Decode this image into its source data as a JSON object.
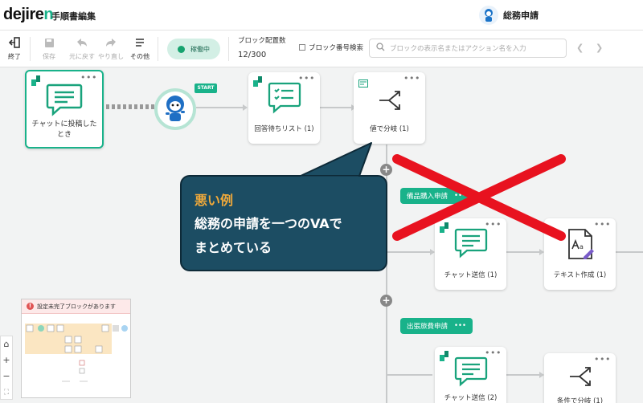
{
  "header": {
    "logo_main": "dejire",
    "logo_accent": "n",
    "title": "手順書編集",
    "project_name": "総務申請"
  },
  "toolbar": {
    "exit": "終了",
    "save": "保存",
    "undo": "元に戻す",
    "redo": "やり直し",
    "more": "その他",
    "status": "稼働中",
    "block_count_label": "ブロック配置数",
    "block_count_value": "12/300",
    "block_search_label": "ブロック番号検索",
    "search_placeholder": "ブロックの表示名またはアクション名を入力",
    "prev_icon": "chevron-left-icon",
    "next_icon": "chevron-right-icon"
  },
  "flow": {
    "trigger_label_l1": "チャットに投稿した",
    "trigger_label_l2": "とき",
    "start_badge": "START",
    "node_wait": "回答待ちリスト (1)",
    "node_branch": "値で分岐 (1)",
    "tag1": "備品購入申請",
    "tag2": "出張旅費申請",
    "tag_more": "•••",
    "node_chat1": "チャット送信 (1)",
    "node_text1": "テキスト作成 (1)",
    "node_chat2": "チャット送信 (2)",
    "node_cond": "条件で分岐 (1)",
    "node_more": "•••"
  },
  "callout": {
    "title": "悪い例",
    "line1": "総務の申請を一つのVAで",
    "line2": "まとめている"
  },
  "minimap": {
    "warning": "設定未完了ブロックがあります"
  },
  "zoom": {
    "home": "⌂",
    "plus": "+",
    "minus": "−",
    "fit": "⛶"
  },
  "colors": {
    "brand": "#19b28a",
    "callout_bg": "#1c4d63",
    "callout_title": "#f0a93a",
    "x_mark": "#e8121f"
  }
}
